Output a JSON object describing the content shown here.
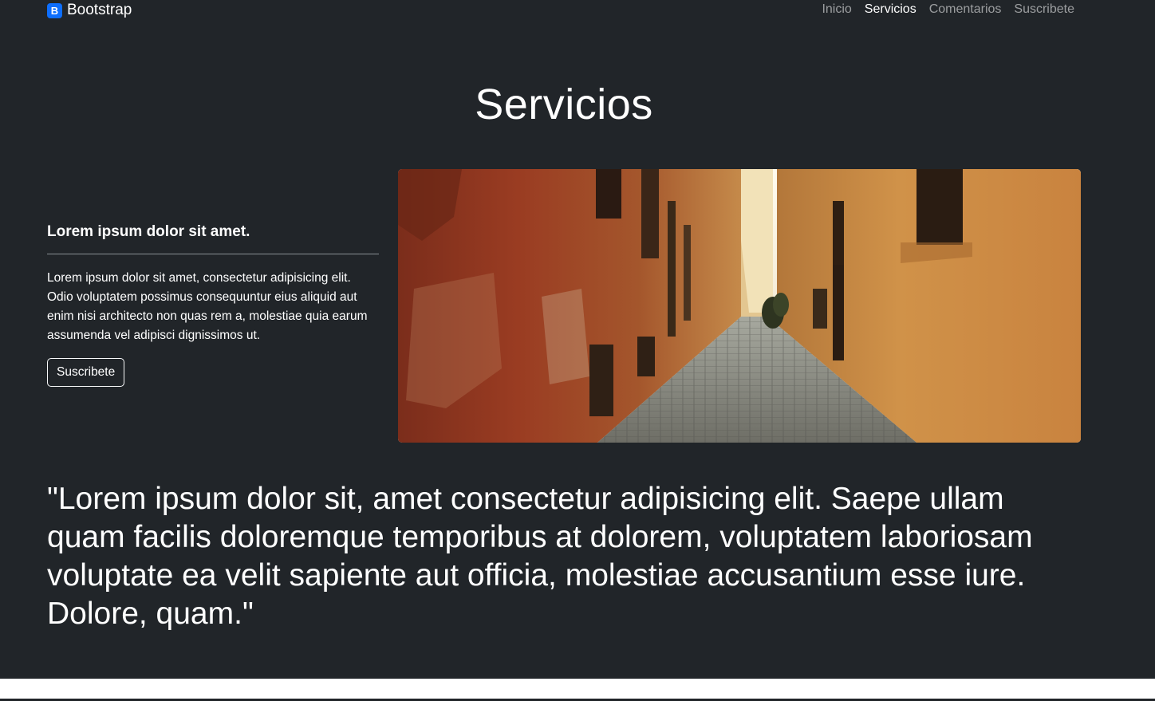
{
  "navbar": {
    "brand_logo": "B",
    "brand_name": "Bootstrap",
    "links": [
      {
        "label": "Inicio",
        "active": false
      },
      {
        "label": "Servicios",
        "active": true
      },
      {
        "label": "Comentarios",
        "active": false
      },
      {
        "label": "Suscribete",
        "active": false
      }
    ]
  },
  "section": {
    "title": "Servicios",
    "feature_heading": "Lorem ipsum dolor sit amet.",
    "feature_text": "Lorem ipsum dolor sit amet, consectetur adipisicing elit. Odio voluptatem possimus consequuntur eius aliquid aut enim nisi architecto non quas rem a, molestiae quia earum assumenda vel adipisci dignissimos ut.",
    "button_label": "Suscribete",
    "image": "narrow-cobblestone-alley-photo"
  },
  "quote": {
    "text": "\"Lorem ipsum dolor sit, amet consectetur adipisicing elit. Saepe ullam quam facilis doloremque temporibus at dolorem, voluptatem laboriosam voluptate ea velit sapiente aut officia, molestiae accusantium esse iure. Dolore, quam.\""
  },
  "colors": {
    "background": "#212529",
    "brand_accent": "#0d6efd",
    "text": "#ffffff",
    "nav_inactive": "rgba(255,255,255,0.55)"
  }
}
